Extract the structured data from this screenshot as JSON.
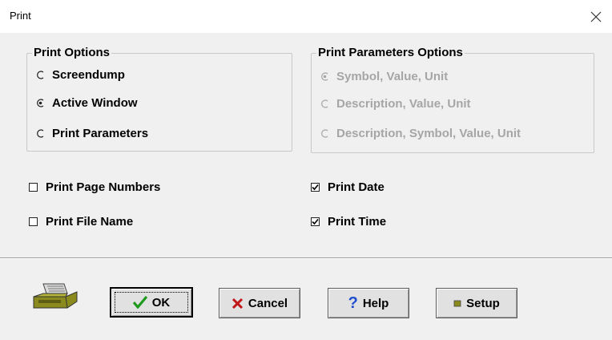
{
  "window": {
    "title": "Print"
  },
  "print_options": {
    "title": "Print Options",
    "items": [
      {
        "label": "Screendump",
        "selected": false
      },
      {
        "label": "Active Window",
        "selected": true
      },
      {
        "label": "Print Parameters",
        "selected": false
      }
    ]
  },
  "param_options": {
    "title": "Print Parameters Options",
    "enabled": false,
    "items": [
      {
        "label": "Symbol, Value, Unit",
        "selected": true
      },
      {
        "label": "Description, Value, Unit",
        "selected": false
      },
      {
        "label": "Description, Symbol, Value, Unit",
        "selected": false
      }
    ]
  },
  "checkboxes": {
    "page_numbers": {
      "label": "Print Page Numbers",
      "checked": false
    },
    "file_name": {
      "label": "Print File Name",
      "checked": false
    },
    "date": {
      "label": "Print Date",
      "checked": true
    },
    "time": {
      "label": "Print Time",
      "checked": true
    }
  },
  "buttons": {
    "ok": "OK",
    "cancel": "Cancel",
    "help": "Help",
    "setup": "Setup"
  },
  "icons": {
    "printer": "printer-icon",
    "ok": "checkmark-icon",
    "cancel": "x-icon",
    "help": "question-icon",
    "setup": "setup-icon",
    "close": "close-icon"
  },
  "colors": {
    "ok_check": "#1f9a1f",
    "cancel_x": "#c01818",
    "help_q": "#1f4fd0",
    "printer_body": "#8a8a1e",
    "disabled_text": "#a6a6a6"
  }
}
